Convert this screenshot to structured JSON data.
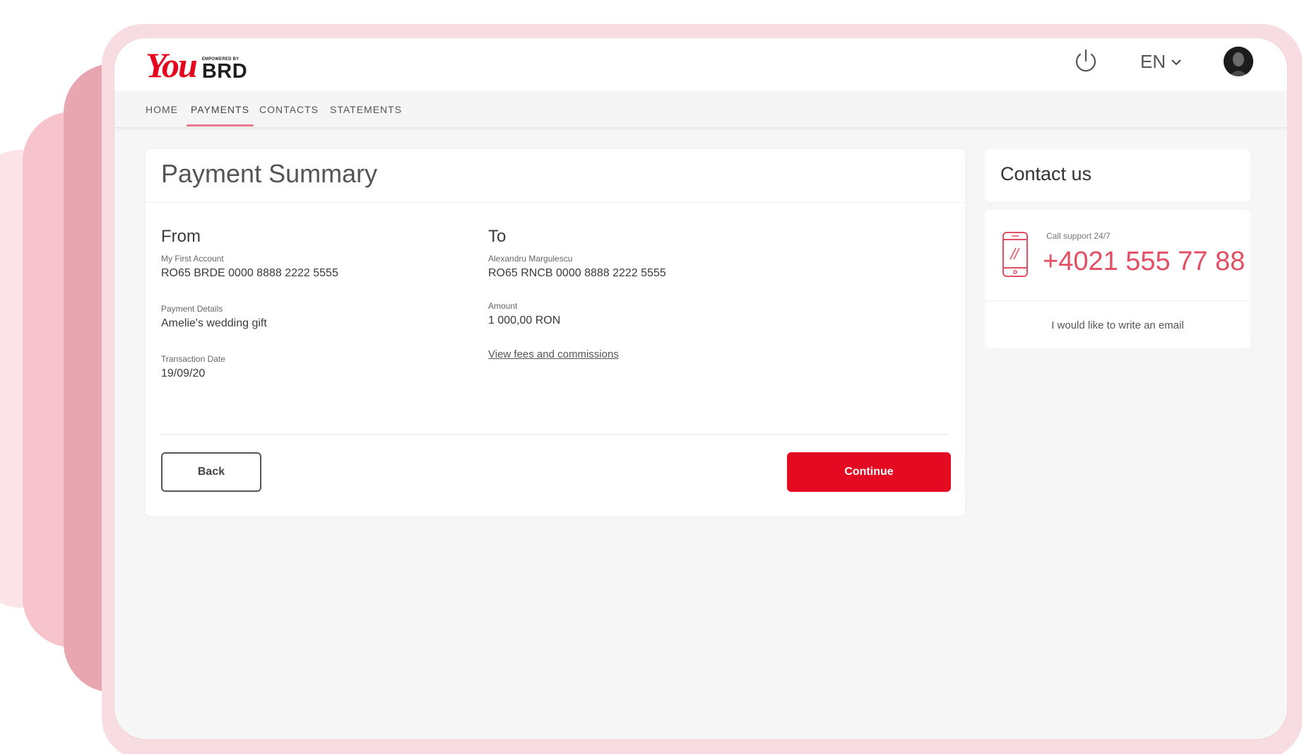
{
  "brand": {
    "logo_main": "You",
    "logo_tagline": "EMPOWERED BY",
    "logo_bank": "BRD",
    "accent_color": "#e40a22"
  },
  "header": {
    "language": "EN",
    "icons": [
      "power-icon",
      "chevron-down-icon",
      "avatar"
    ]
  },
  "nav": {
    "items": [
      {
        "label": "HOME",
        "active": false
      },
      {
        "label": "PAYMENTS",
        "active": true
      },
      {
        "label": "CONTACTS",
        "active": false
      },
      {
        "label": "STATEMENTS",
        "active": false
      }
    ]
  },
  "summary": {
    "title": "Payment Summary",
    "from": {
      "heading": "From",
      "account_label": "My First Account",
      "account_iban": "RO65 BRDE 0000 8888 2222 5555",
      "details_label": "Payment Details",
      "details_value": "Amelie's wedding gift",
      "date_label": "Transaction Date",
      "date_value": "19/09/20"
    },
    "to": {
      "heading": "To",
      "payee_label": "Alexandru Margulescu",
      "payee_iban": "RO65 RNCB 0000 8888 2222 5555",
      "amount_label": "Amount",
      "amount_value": "1 000,00 RON",
      "fees_link": "View fees and commissions"
    },
    "back_label": "Back",
    "continue_label": "Continue"
  },
  "contact": {
    "title": "Contact us",
    "support_label": "Call support 24/7",
    "phone": "+4021 555 77 88",
    "email_link": "I would like to write an email"
  }
}
